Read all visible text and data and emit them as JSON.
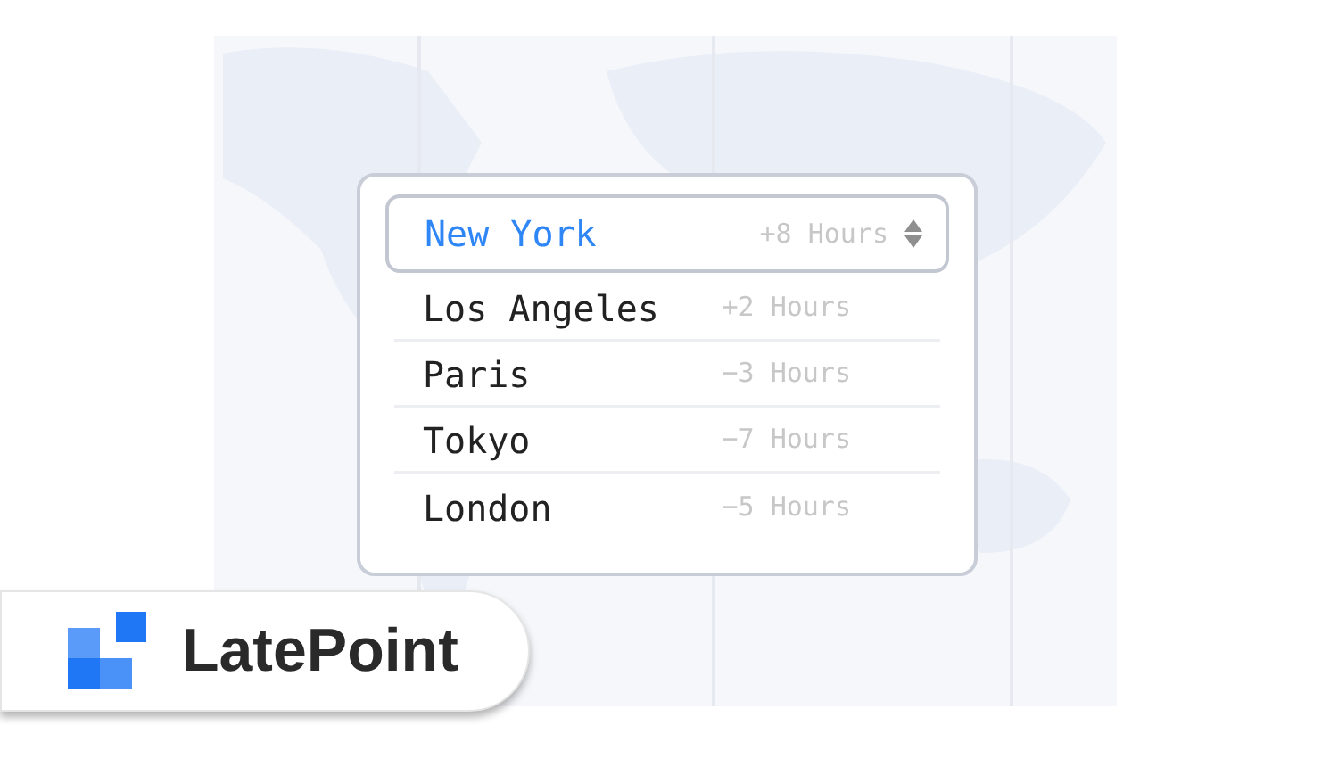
{
  "timezone_select": {
    "options": [
      {
        "city": "New York",
        "offset": "+8 Hours",
        "selected": true
      },
      {
        "city": "Los Angeles",
        "offset": "+2 Hours",
        "selected": false
      },
      {
        "city": "Paris",
        "offset": "−3 Hours",
        "selected": false
      },
      {
        "city": "Tokyo",
        "offset": "−7 Hours",
        "selected": false
      },
      {
        "city": "London",
        "offset": "−5 Hours",
        "selected": false
      }
    ]
  },
  "brand": {
    "name": "LatePoint"
  }
}
